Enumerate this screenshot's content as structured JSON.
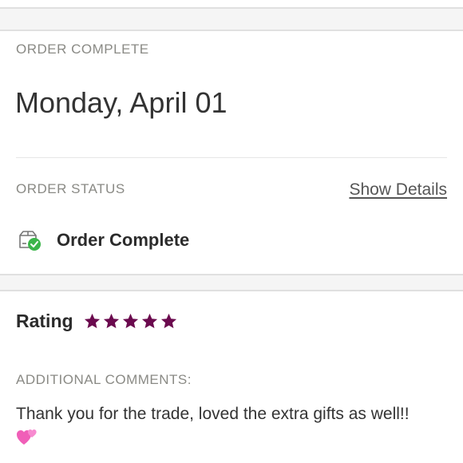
{
  "order": {
    "header_label": "ORDER COMPLETE",
    "date": "Monday, April 01"
  },
  "status": {
    "label": "ORDER STATUS",
    "show_details": "Show Details",
    "icon": "package-check-icon",
    "text": "Order Complete",
    "check_color": "#3bb54a"
  },
  "rating": {
    "label": "Rating",
    "stars": 5,
    "max_stars": 5,
    "star_color": "#6b0a4e"
  },
  "comments": {
    "label": "ADDITIONAL COMMENTS:",
    "text": "Thank you for the trade, loved the extra gifts as well!!",
    "emoji_icon": "two-hearts-icon"
  }
}
